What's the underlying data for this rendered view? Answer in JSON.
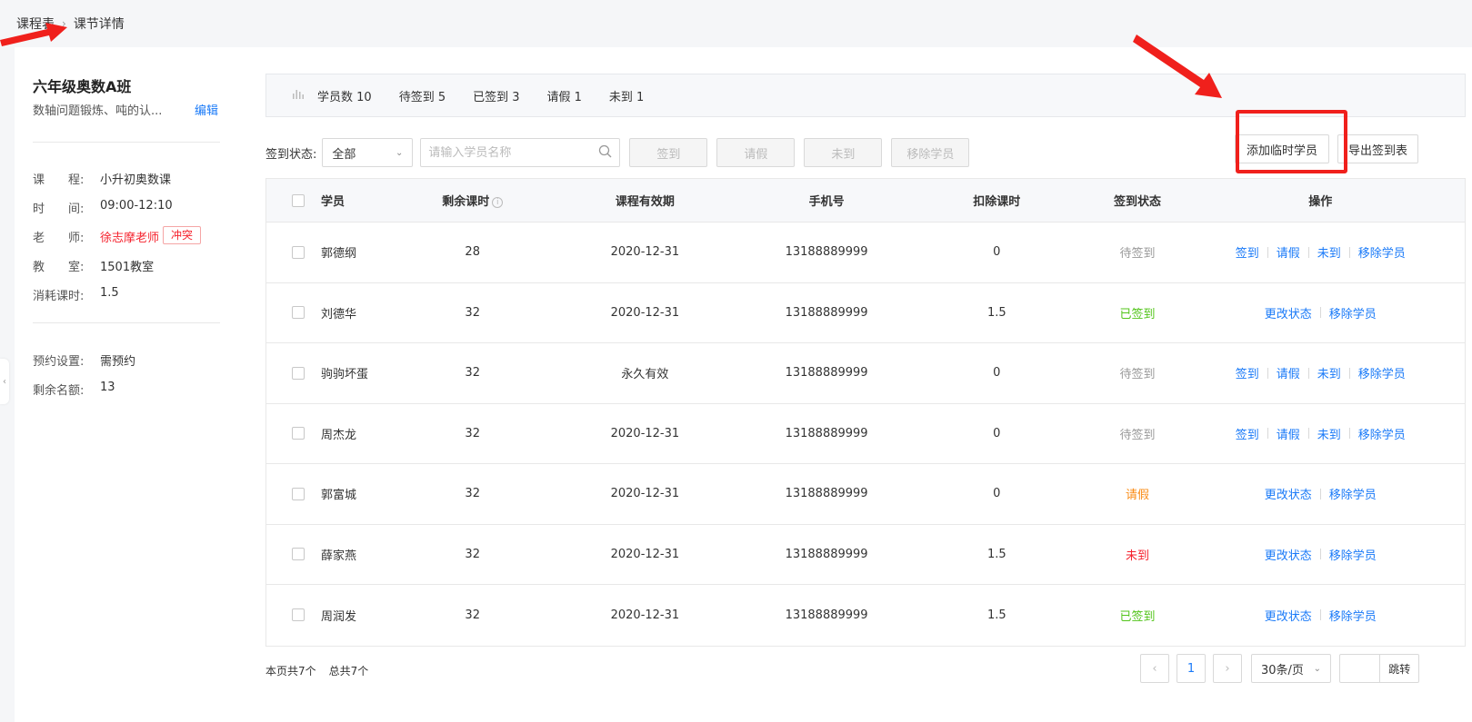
{
  "breadcrumb": {
    "parent": "课程表",
    "current": "课节详情"
  },
  "class_info": {
    "title": "六年级奥数A班",
    "description": "数轴问题锻炼、吨的认...",
    "edit_label": "编辑",
    "fields": [
      {
        "label": "课　　程:",
        "value": "小升初奥数课"
      },
      {
        "label": "时　　间:",
        "value": "09:00-12:10"
      },
      {
        "label": "老　　师:",
        "value": "徐志摩老师"
      },
      {
        "label": "教　　室:",
        "value": "1501教室"
      },
      {
        "label": "消耗课时:",
        "value": "1.5"
      }
    ],
    "conflict_tag": "冲突",
    "booking": {
      "label": "预约设置:",
      "value": "需预约"
    },
    "remaining": {
      "label": "剩余名额:",
      "value": "13"
    }
  },
  "stats": {
    "students": "学员数 10",
    "pending": "待签到 5",
    "signed": "已签到 3",
    "leave": "请假 1",
    "absent": "未到 1"
  },
  "filter": {
    "status_label": "签到状态:",
    "status_value": "全部",
    "search_placeholder": "请输入学员名称",
    "buttons": [
      "签到",
      "请假",
      "未到",
      "移除学员"
    ]
  },
  "actions": {
    "add_temp": "添加临时学员",
    "export": "导出签到表"
  },
  "table": {
    "headers": [
      "学员",
      "剩余课时",
      "课程有效期",
      "手机号",
      "扣除课时",
      "签到状态",
      "操作"
    ],
    "rows": [
      {
        "name": "郭德纲",
        "hours": "28",
        "valid": "2020-12-31",
        "phone": "13188889999",
        "deduct": "0",
        "status": "待签到",
        "ops": [
          "签到",
          "请假",
          "未到",
          "移除学员"
        ]
      },
      {
        "name": "刘德华",
        "hours": "32",
        "valid": "2020-12-31",
        "phone": "13188889999",
        "deduct": "1.5",
        "status": "已签到",
        "ops": [
          "更改状态",
          "移除学员"
        ]
      },
      {
        "name": "驹驹坏蛋",
        "hours": "32",
        "valid": "永久有效",
        "phone": "13188889999",
        "deduct": "0",
        "status": "待签到",
        "ops": [
          "签到",
          "请假",
          "未到",
          "移除学员"
        ]
      },
      {
        "name": "周杰龙",
        "hours": "32",
        "valid": "2020-12-31",
        "phone": "13188889999",
        "deduct": "0",
        "status": "待签到",
        "ops": [
          "签到",
          "请假",
          "未到",
          "移除学员"
        ]
      },
      {
        "name": "郭富城",
        "hours": "32",
        "valid": "2020-12-31",
        "phone": "13188889999",
        "deduct": "0",
        "status": "请假",
        "ops": [
          "更改状态",
          "移除学员"
        ]
      },
      {
        "name": "薛家燕",
        "hours": "32",
        "valid": "2020-12-31",
        "phone": "13188889999",
        "deduct": "1.5",
        "status": "未到",
        "ops": [
          "更改状态",
          "移除学员"
        ]
      },
      {
        "name": "周润发",
        "hours": "32",
        "valid": "2020-12-31",
        "phone": "13188889999",
        "deduct": "1.5",
        "status": "已签到",
        "ops": [
          "更改状态",
          "移除学员"
        ]
      }
    ]
  },
  "footer": {
    "page_count": "本页共7个",
    "total_count": "总共7个",
    "current_page": "1",
    "page_size": "30条/页",
    "jump": "跳转"
  },
  "colors": {
    "accent": "#1a7af8",
    "annotation_red": "#f0201c",
    "signed": "#52c41a",
    "leave": "#fa8c16",
    "absent": "#f5222d"
  }
}
